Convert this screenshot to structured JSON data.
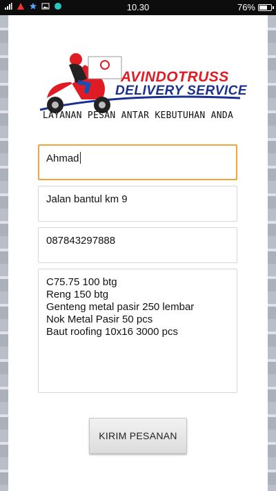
{
  "statusbar": {
    "time": "10.30",
    "battery": "76%",
    "battery_level": 0.76
  },
  "brand": {
    "line1": "AVINDOTRUSS",
    "line2": "DELIVERY SERVICE",
    "box_label": "DELIVERY SERVICE",
    "tagline": "LAYANAN PESAN ANTAR KEBUTUHAN ANDA"
  },
  "form": {
    "name": "Ahmad",
    "address": "Jalan bantul km 9",
    "phone": "087843297888",
    "order_lines": [
      "C75.75 100 btg",
      "Reng 150 btg",
      "Genteng metal pasir 250 lembar",
      "Nok Metal Pasir 50 pcs",
      "Baut roofing 10x16 3000 pcs"
    ]
  },
  "submit_label": "KIRIM PESANAN",
  "colors": {
    "brand_red": "#e11b24",
    "brand_blue": "#1a2f8f",
    "focus": "#f0a43a"
  }
}
